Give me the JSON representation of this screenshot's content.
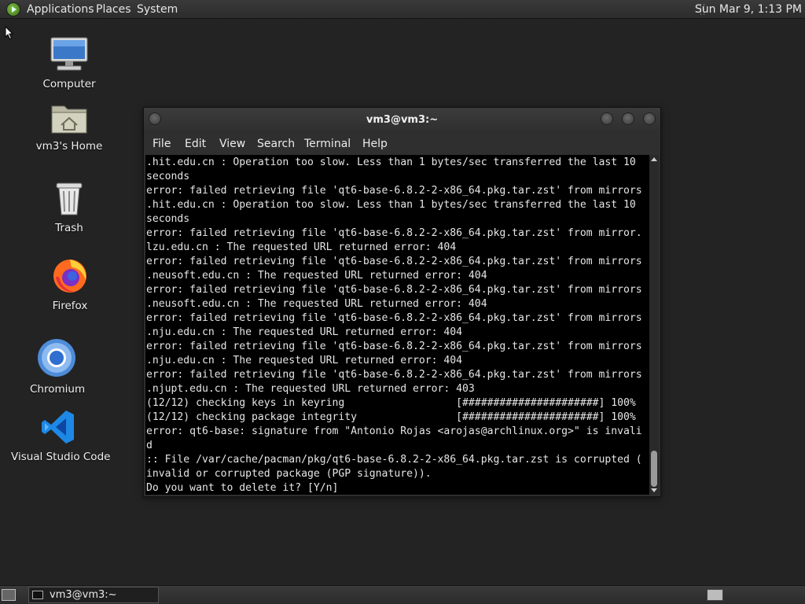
{
  "top_panel": {
    "menus": [
      "Applications",
      "Places",
      "System"
    ],
    "clock": "Sun Mar  9,  1:13 PM"
  },
  "desktop": {
    "icons": [
      {
        "label": "Computer",
        "icon": "computer-icon"
      },
      {
        "label": "vm3's Home",
        "icon": "home-folder-icon"
      },
      {
        "label": "Trash",
        "icon": "trash-icon"
      },
      {
        "label": "Firefox",
        "icon": "firefox-icon"
      },
      {
        "label": "Chromium",
        "icon": "chromium-icon"
      },
      {
        "label": "Visual Studio Code",
        "icon": "vscode-icon"
      }
    ]
  },
  "terminal_window": {
    "title": "vm3@vm3:~",
    "menu": [
      "File",
      "Edit",
      "View",
      "Search",
      "Terminal",
      "Help"
    ],
    "lines": [
      ".hit.edu.cn : Operation too slow. Less than 1 bytes/sec transferred the last 10",
      "seconds",
      "error: failed retrieving file 'qt6-base-6.8.2-2-x86_64.pkg.tar.zst' from mirrors",
      ".hit.edu.cn : Operation too slow. Less than 1 bytes/sec transferred the last 10",
      "seconds",
      "error: failed retrieving file 'qt6-base-6.8.2-2-x86_64.pkg.tar.zst' from mirror.",
      "lzu.edu.cn : The requested URL returned error: 404",
      "error: failed retrieving file 'qt6-base-6.8.2-2-x86_64.pkg.tar.zst' from mirrors",
      ".neusoft.edu.cn : The requested URL returned error: 404",
      "error: failed retrieving file 'qt6-base-6.8.2-2-x86_64.pkg.tar.zst' from mirrors",
      ".neusoft.edu.cn : The requested URL returned error: 404",
      "error: failed retrieving file 'qt6-base-6.8.2-2-x86_64.pkg.tar.zst' from mirrors",
      ".nju.edu.cn : The requested URL returned error: 404",
      "error: failed retrieving file 'qt6-base-6.8.2-2-x86_64.pkg.tar.zst' from mirrors",
      ".nju.edu.cn : The requested URL returned error: 404",
      "error: failed retrieving file 'qt6-base-6.8.2-2-x86_64.pkg.tar.zst' from mirrors",
      ".njupt.edu.cn : The requested URL returned error: 403",
      "(12/12) checking keys in keyring                  [######################] 100%",
      "(12/12) checking package integrity                [######################] 100%",
      "error: qt6-base: signature from \"Antonio Rojas <arojas@archlinux.org>\" is invali",
      "d",
      ":: File /var/cache/pacman/pkg/qt6-base-6.8.2-2-x86_64.pkg.tar.zst is corrupted (",
      "invalid or corrupted package (PGP signature)).",
      "Do you want to delete it? [Y/n]"
    ]
  },
  "bottom_panel": {
    "task_label": "vm3@vm3:~"
  }
}
